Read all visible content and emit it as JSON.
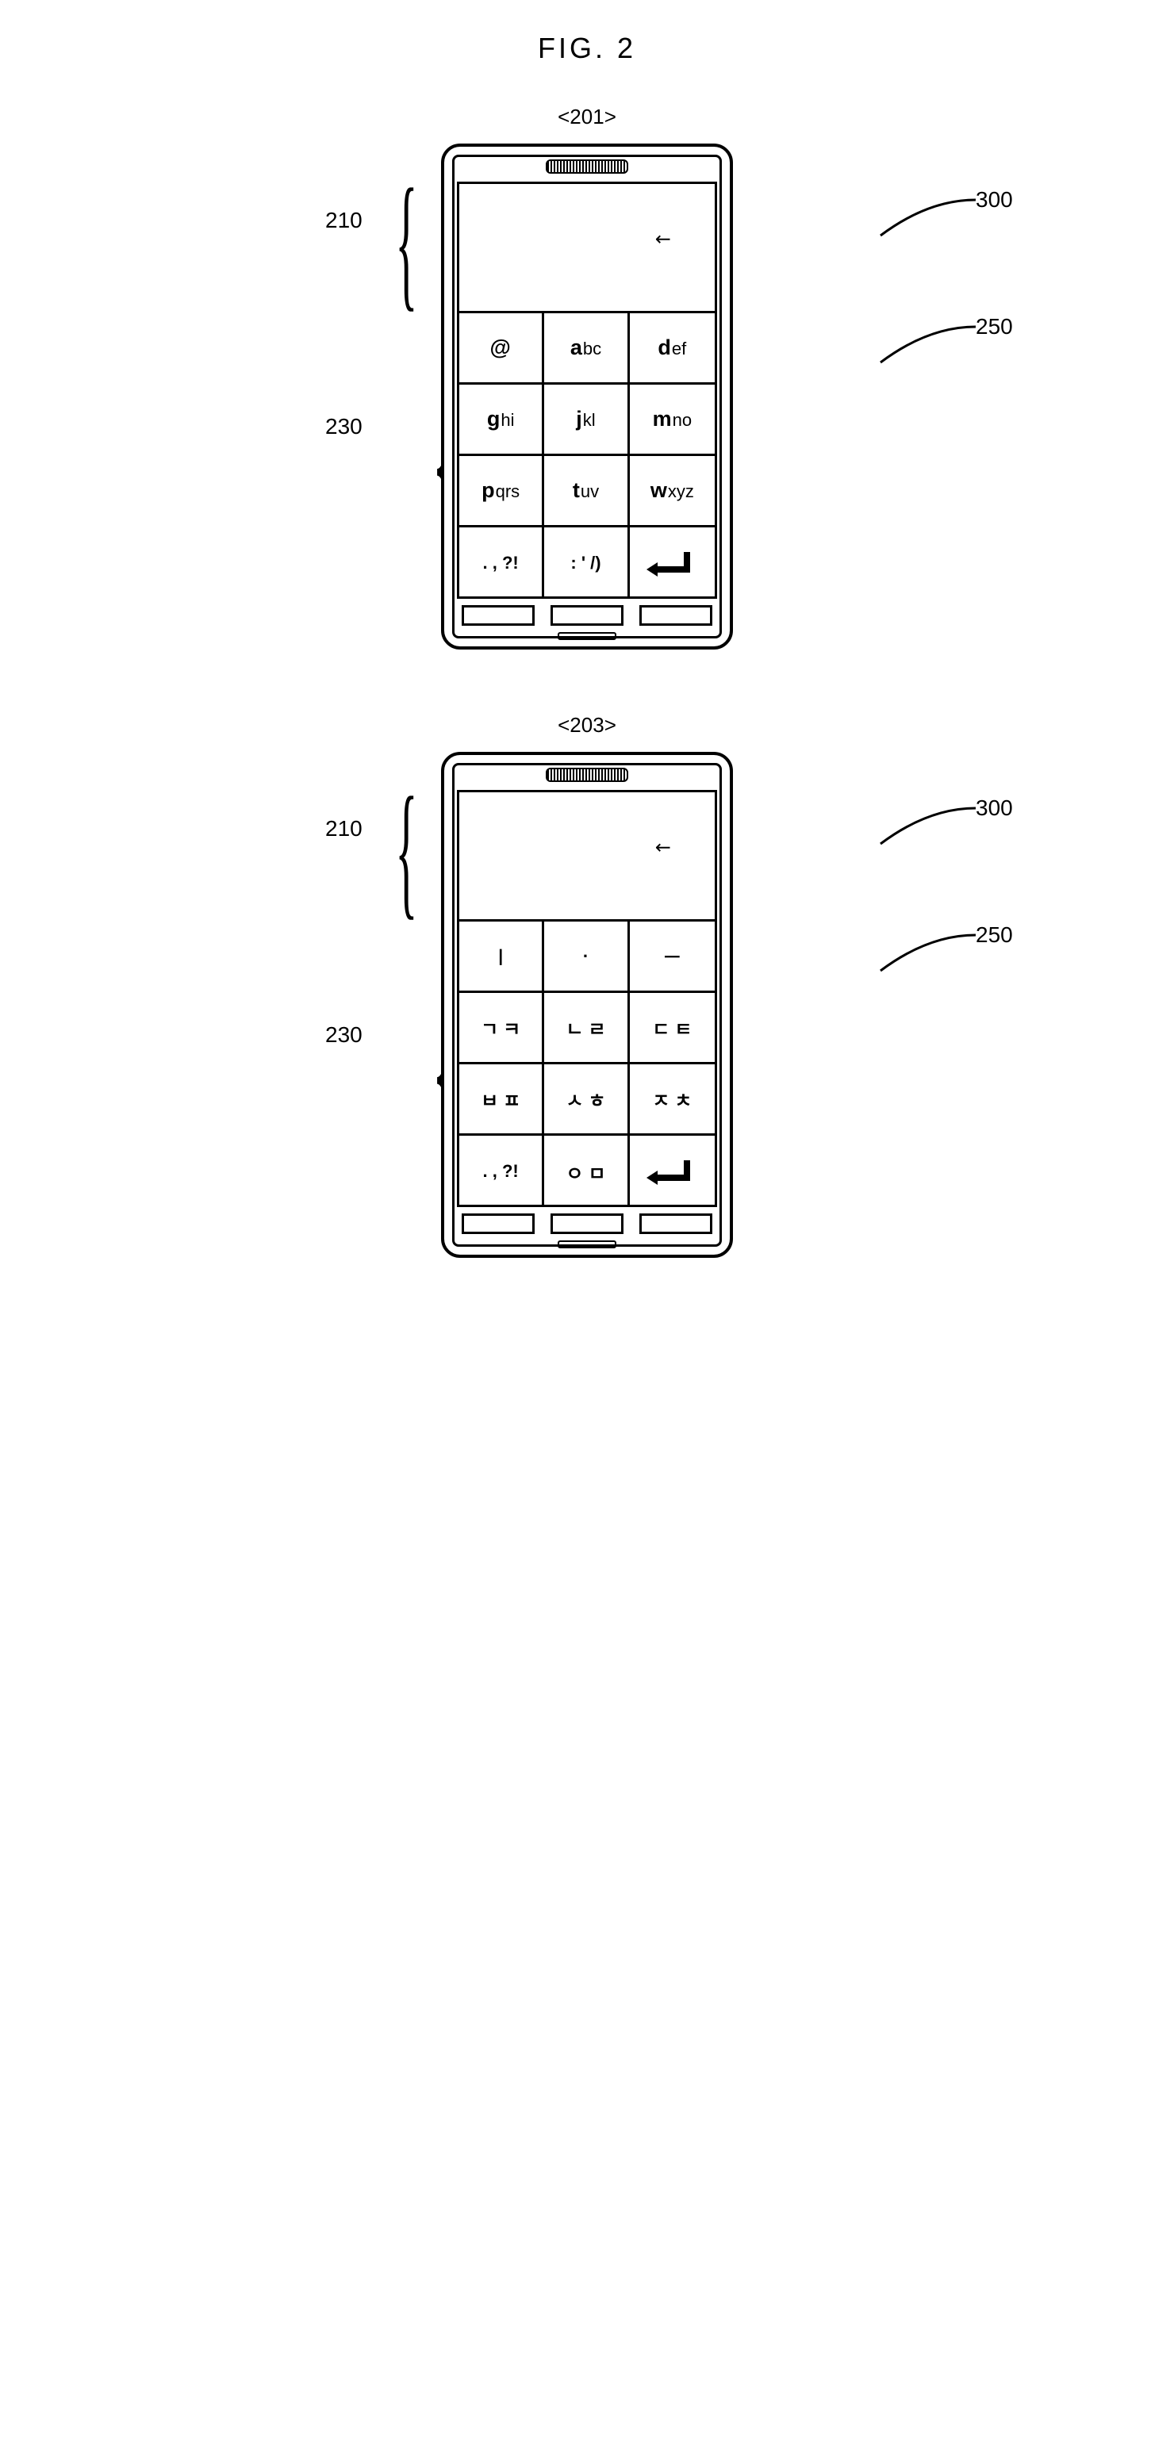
{
  "figure_title": "FIG. 2",
  "panels": [
    {
      "id": "201",
      "title": "<201>",
      "ref_display": "300",
      "ref_keypad_grid": "250",
      "ref_display_zone": "210",
      "ref_input_zone": "230",
      "keys": [
        {
          "bold": "@",
          "rest": ""
        },
        {
          "bold": "a",
          "rest": "bc"
        },
        {
          "bold": "d",
          "rest": "ef"
        },
        {
          "bold": "g",
          "rest": "hi"
        },
        {
          "bold": "j",
          "rest": "kl"
        },
        {
          "bold": "m",
          "rest": "no"
        },
        {
          "bold": "p",
          "rest": "qrs"
        },
        {
          "bold": "t",
          "rest": "uv"
        },
        {
          "bold": "w",
          "rest": "xyz"
        },
        {
          "raw": ". , ?!"
        },
        {
          "raw": ": ' /)"
        },
        {
          "enter": true
        }
      ]
    },
    {
      "id": "203",
      "title": "<203>",
      "ref_display": "300",
      "ref_keypad_grid": "250",
      "ref_display_zone": "210",
      "ref_input_zone": "230",
      "keys": [
        {
          "raw": "ㅣ"
        },
        {
          "raw": "·"
        },
        {
          "raw": "ㅡ"
        },
        {
          "pair": [
            "ㄱ",
            "ㅋ"
          ]
        },
        {
          "pair": [
            "ㄴ",
            "ㄹ"
          ]
        },
        {
          "pair": [
            "ㄷ",
            "ㅌ"
          ]
        },
        {
          "pair": [
            "ㅂ",
            "ㅍ"
          ]
        },
        {
          "pair": [
            "ㅅ",
            "ㅎ"
          ]
        },
        {
          "pair": [
            "ㅈ",
            "ㅊ"
          ]
        },
        {
          "raw": ". , ?!"
        },
        {
          "pair": [
            "ㅇ",
            "ㅁ"
          ]
        },
        {
          "enter": true
        }
      ]
    }
  ]
}
